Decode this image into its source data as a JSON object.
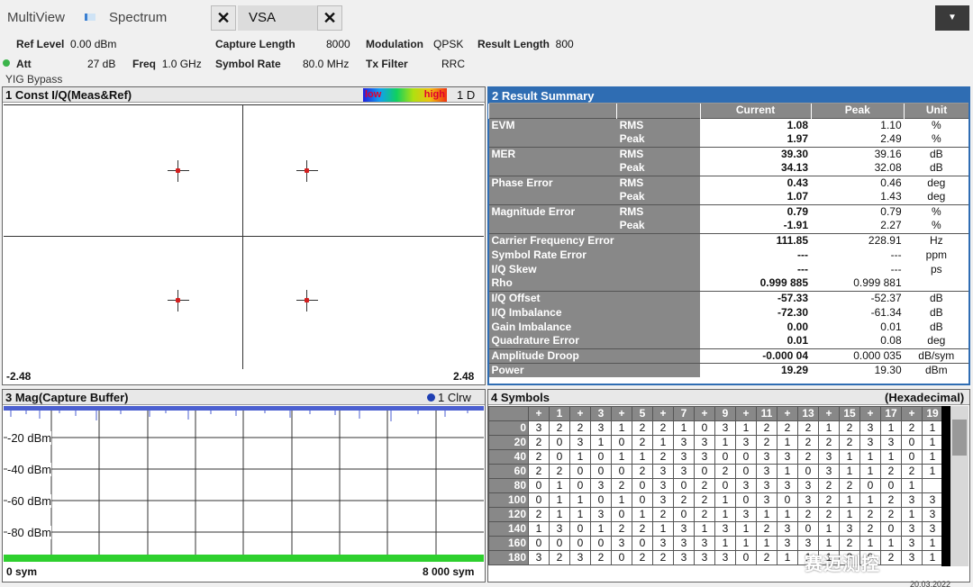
{
  "tabs": {
    "multiview": "MultiView",
    "spectrum": "Spectrum",
    "vsa": "VSA",
    "close": "✕",
    "dropdown": "▼"
  },
  "settings": {
    "ref_level_label": "Ref Level",
    "ref_level_value": "0.00 dBm",
    "att_label": "Att",
    "att_value": "27 dB",
    "freq_label": "Freq",
    "freq_value": "1.0 GHz",
    "capture_length_label": "Capture Length",
    "capture_length_value": "8000",
    "symbol_rate_label": "Symbol Rate",
    "symbol_rate_value": "80.0 MHz",
    "modulation_label": "Modulation",
    "modulation_value": "QPSK",
    "tx_filter_label": "Tx Filter",
    "tx_filter_value": "RRC",
    "result_length_label": "Result Length",
    "result_length_value": "800",
    "yig": "YIG Bypass"
  },
  "const_panel": {
    "title": "1 Const I/Q(Meas&Ref)",
    "legend_low": "low",
    "legend_high": "high",
    "trace": "1 D",
    "x_min": "-2.48",
    "x_max": "2.48"
  },
  "result_summary": {
    "title": "2 Result Summary",
    "headers": [
      "Current",
      "Peak",
      "Unit"
    ],
    "rows": [
      {
        "label": "EVM",
        "sub": "RMS",
        "current": "1.08",
        "peak": "1.10",
        "unit": "%"
      },
      {
        "label": "",
        "sub": "Peak",
        "current": "1.97",
        "peak": "2.49",
        "unit": "%"
      },
      {
        "label": "MER",
        "sub": "RMS",
        "current": "39.30",
        "peak": "39.16",
        "unit": "dB"
      },
      {
        "label": "",
        "sub": "Peak",
        "current": "34.13",
        "peak": "32.08",
        "unit": "dB"
      },
      {
        "label": "Phase Error",
        "sub": "RMS",
        "current": "0.43",
        "peak": "0.46",
        "unit": "deg"
      },
      {
        "label": "",
        "sub": "Peak",
        "current": "1.07",
        "peak": "1.43",
        "unit": "deg"
      },
      {
        "label": "Magnitude Error",
        "sub": "RMS",
        "current": "0.79",
        "peak": "0.79",
        "unit": "%"
      },
      {
        "label": "",
        "sub": "Peak",
        "current": "-1.91",
        "peak": "2.27",
        "unit": "%"
      },
      {
        "label": "Carrier Frequency Error",
        "sub": "",
        "current": "111.85",
        "peak": "228.91",
        "unit": "Hz"
      },
      {
        "label": "Symbol Rate Error",
        "sub": "",
        "current": "---",
        "peak": "---",
        "unit": "ppm"
      },
      {
        "label": "I/Q Skew",
        "sub": "",
        "current": "---",
        "peak": "---",
        "unit": "ps"
      },
      {
        "label": "Rho",
        "sub": "",
        "current": "0.999 885",
        "peak": "0.999 881",
        "unit": ""
      },
      {
        "label": "I/Q Offset",
        "sub": "",
        "current": "-57.33",
        "peak": "-52.37",
        "unit": "dB"
      },
      {
        "label": "I/Q Imbalance",
        "sub": "",
        "current": "-72.30",
        "peak": "-61.34",
        "unit": "dB"
      },
      {
        "label": "Gain Imbalance",
        "sub": "",
        "current": "0.00",
        "peak": "0.01",
        "unit": "dB"
      },
      {
        "label": "Quadrature Error",
        "sub": "",
        "current": "0.01",
        "peak": "0.08",
        "unit": "deg"
      },
      {
        "label": "Amplitude Droop",
        "sub": "",
        "current": "-0.000 04",
        "peak": "0.000 035",
        "unit": "dB/sym"
      },
      {
        "label": "Power",
        "sub": "",
        "current": "19.29",
        "peak": "19.30",
        "unit": "dBm"
      }
    ]
  },
  "mag_panel": {
    "title": "3 Mag(Capture Buffer)",
    "trace": "1 Clrw",
    "y_labels": [
      "-20 dBm",
      "-40 dBm",
      "-60 dBm",
      "-80 dBm"
    ],
    "x_min": "0 sym",
    "x_max": "8 000 sym"
  },
  "symbols_panel": {
    "title": "4 Symbols",
    "format": "(Hexadecimal)",
    "col_headers": [
      "+",
      "1",
      "+",
      "3",
      "+",
      "5",
      "+",
      "7",
      "+",
      "9",
      "+",
      "11",
      "+",
      "13",
      "+",
      "15",
      "+",
      "17",
      "+",
      "19"
    ],
    "rows": [
      {
        "idx": "0",
        "vals": [
          "3",
          "2",
          "2",
          "3",
          "1",
          "2",
          "2",
          "1",
          "0",
          "3",
          "1",
          "2",
          "2",
          "2",
          "1",
          "2",
          "3",
          "1",
          "2",
          "1"
        ]
      },
      {
        "idx": "20",
        "vals": [
          "2",
          "0",
          "3",
          "1",
          "0",
          "2",
          "1",
          "3",
          "3",
          "1",
          "3",
          "2",
          "1",
          "2",
          "2",
          "2",
          "3",
          "3",
          "0",
          "1"
        ]
      },
      {
        "idx": "40",
        "vals": [
          "2",
          "0",
          "1",
          "0",
          "1",
          "1",
          "2",
          "3",
          "3",
          "0",
          "0",
          "3",
          "3",
          "2",
          "3",
          "1",
          "1",
          "1",
          "0",
          "1"
        ]
      },
      {
        "idx": "60",
        "vals": [
          "2",
          "2",
          "0",
          "0",
          "0",
          "2",
          "3",
          "3",
          "0",
          "2",
          "0",
          "3",
          "1",
          "0",
          "3",
          "1",
          "1",
          "2",
          "2",
          "1"
        ]
      },
      {
        "idx": "80",
        "vals": [
          "0",
          "1",
          "0",
          "3",
          "2",
          "0",
          "3",
          "0",
          "2",
          "0",
          "3",
          "3",
          "3",
          "3",
          "2",
          "2",
          "0",
          "0",
          "1",
          ""
        ]
      },
      {
        "idx": "100",
        "vals": [
          "0",
          "1",
          "1",
          "0",
          "1",
          "0",
          "3",
          "2",
          "2",
          "1",
          "0",
          "3",
          "0",
          "3",
          "2",
          "1",
          "1",
          "2",
          "3",
          "3"
        ]
      },
      {
        "idx": "120",
        "vals": [
          "2",
          "1",
          "1",
          "3",
          "0",
          "1",
          "2",
          "0",
          "2",
          "1",
          "3",
          "1",
          "1",
          "2",
          "2",
          "1",
          "2",
          "2",
          "1",
          "3"
        ]
      },
      {
        "idx": "140",
        "vals": [
          "1",
          "3",
          "0",
          "1",
          "2",
          "2",
          "1",
          "3",
          "1",
          "3",
          "1",
          "2",
          "3",
          "0",
          "1",
          "3",
          "2",
          "0",
          "3",
          "3"
        ]
      },
      {
        "idx": "160",
        "vals": [
          "0",
          "0",
          "0",
          "0",
          "3",
          "0",
          "3",
          "3",
          "3",
          "1",
          "1",
          "1",
          "3",
          "3",
          "1",
          "2",
          "1",
          "1",
          "3",
          "1"
        ]
      },
      {
        "idx": "180",
        "vals": [
          "3",
          "2",
          "3",
          "2",
          "0",
          "2",
          "2",
          "3",
          "3",
          "3",
          "0",
          "2",
          "1",
          "1",
          "1",
          "3",
          "0",
          "2",
          "3",
          "1"
        ]
      }
    ]
  },
  "watermark": "赛迈测控",
  "date": "20.03.2022"
}
